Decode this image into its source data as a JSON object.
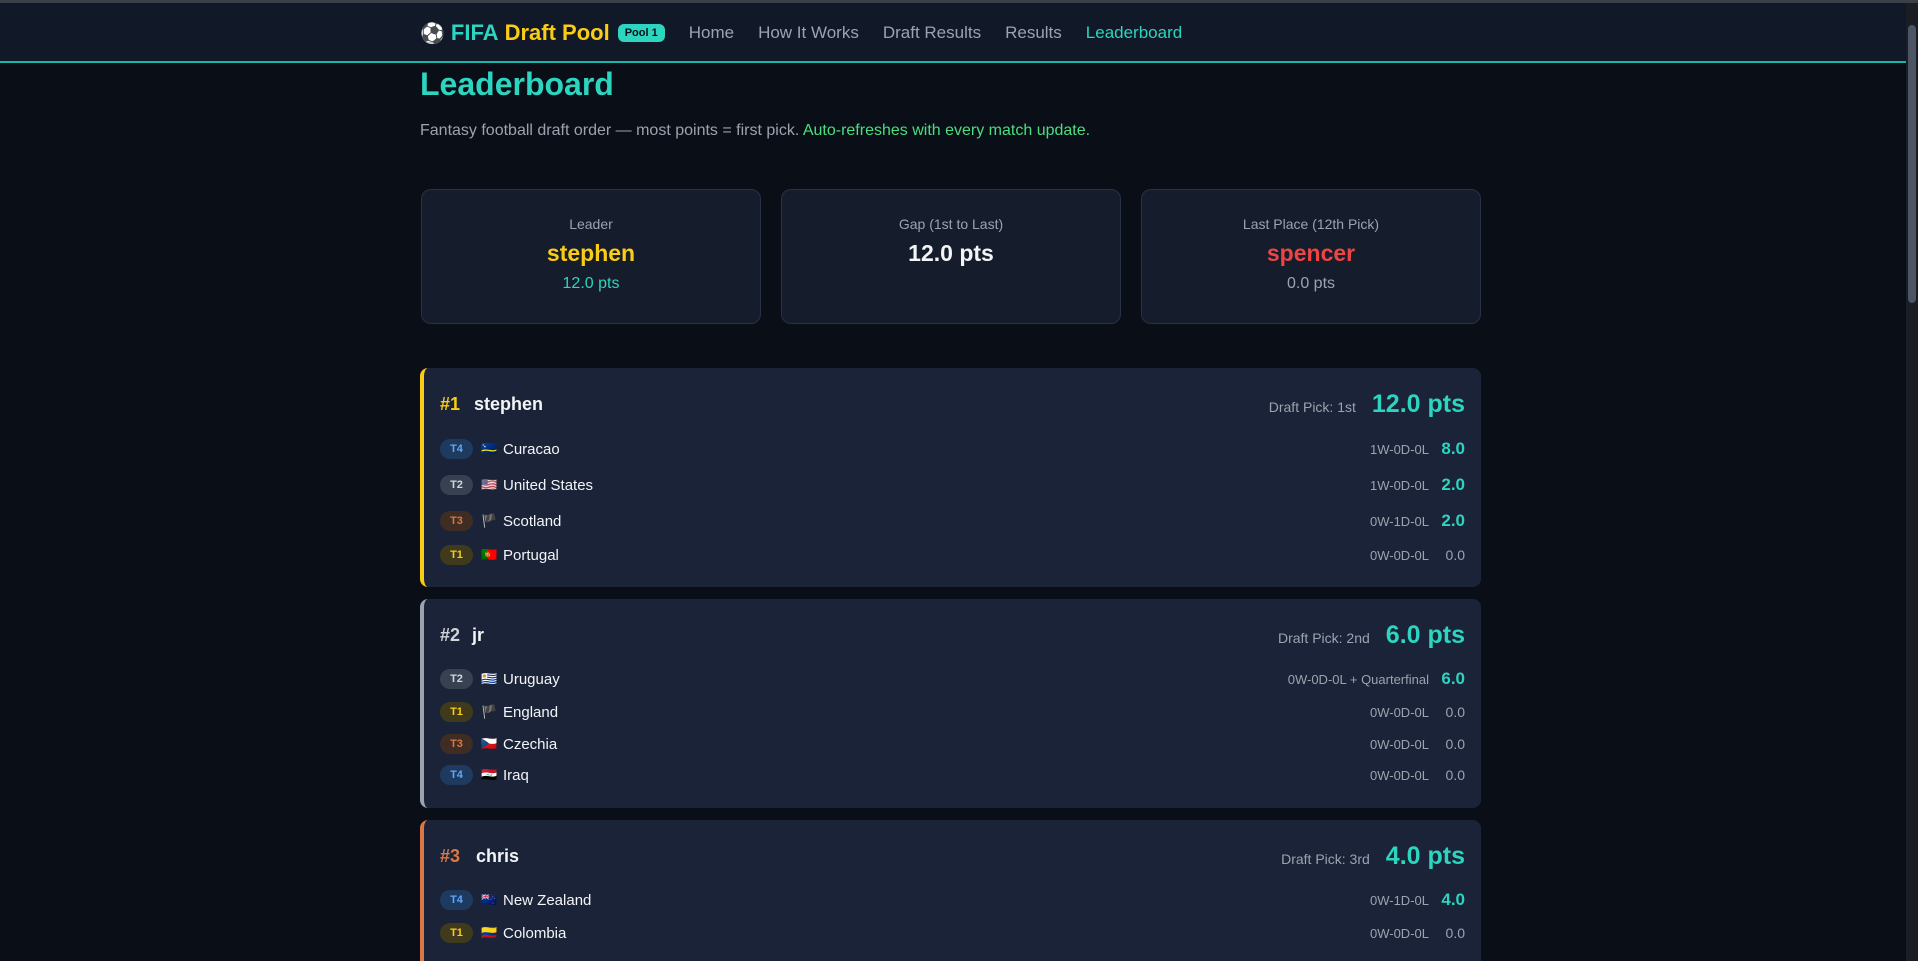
{
  "nav": {
    "ball_icon": "⚽",
    "brand_part1": "FIFA",
    "brand_part2": "Draft Pool",
    "pool_badge": "Pool 1",
    "links": [
      "Home",
      "How It Works",
      "Draft Results",
      "Results",
      "Leaderboard"
    ],
    "active": "Leaderboard"
  },
  "page": {
    "title": "Leaderboard",
    "subtitle": "Fantasy football draft order — most points = first pick.",
    "subtitle_accent": "Auto-refreshes with every match update."
  },
  "stats": {
    "leader": {
      "label": "Leader",
      "value": "stephen",
      "sub": "12.0 pts"
    },
    "gap": {
      "label": "Gap (1st to Last)",
      "value": "12.0 pts"
    },
    "last": {
      "label": "Last Place (12th Pick)",
      "value": "spencer",
      "sub": "0.0 pts"
    }
  },
  "teams": [
    {
      "rank": "#1",
      "owner": "stephen",
      "draft_pick": "Draft Pick: 1st",
      "total": "12.0 pts",
      "rows": [
        {
          "tier": "T4",
          "flag": "🇨🇼",
          "country": "Curacao",
          "record": "1W-0D-0L",
          "pts": "8.0"
        },
        {
          "tier": "T2",
          "flag": "🇺🇸",
          "country": "United States",
          "record": "1W-0D-0L",
          "pts": "2.0"
        },
        {
          "tier": "T3",
          "flag": "🏴",
          "country": "Scotland",
          "record": "0W-1D-0L",
          "pts": "2.0"
        },
        {
          "tier": "T1",
          "flag": "🇵🇹",
          "country": "Portugal",
          "record": "0W-0D-0L",
          "pts": "0.0"
        }
      ]
    },
    {
      "rank": "#2",
      "owner": "jr",
      "draft_pick": "Draft Pick: 2nd",
      "total": "6.0 pts",
      "rows": [
        {
          "tier": "T2",
          "flag": "🇺🇾",
          "country": "Uruguay",
          "record": "0W-0D-0L + Quarterfinal",
          "pts": "6.0"
        },
        {
          "tier": "T1",
          "flag": "🏴",
          "country": "England",
          "record": "0W-0D-0L",
          "pts": "0.0"
        },
        {
          "tier": "T3",
          "flag": "🇨🇿",
          "country": "Czechia",
          "record": "0W-0D-0L",
          "pts": "0.0"
        },
        {
          "tier": "T4",
          "flag": "🇮🇶",
          "country": "Iraq",
          "record": "0W-0D-0L",
          "pts": "0.0"
        }
      ]
    },
    {
      "rank": "#3",
      "owner": "chris",
      "draft_pick": "Draft Pick: 3rd",
      "total": "4.0 pts",
      "rows": [
        {
          "tier": "T4",
          "flag": "🇳🇿",
          "country": "New Zealand",
          "record": "0W-1D-0L",
          "pts": "4.0"
        },
        {
          "tier": "T1",
          "flag": "🇨🇴",
          "country": "Colombia",
          "record": "0W-0D-0L",
          "pts": "0.0"
        }
      ]
    }
  ],
  "colors": {
    "accent": "#2dd4bf",
    "gold": "#facc15",
    "silver": "#9ca3af",
    "bronze": "#d97745",
    "danger": "#ef4444",
    "success": "#4ade80"
  }
}
